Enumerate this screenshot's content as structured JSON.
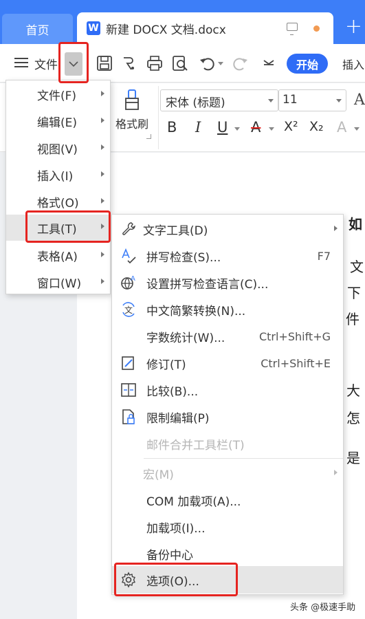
{
  "tabs": {
    "home": "首页",
    "document": "新建 DOCX 文档.docx",
    "doc_icon_letter": "W"
  },
  "toolbar": {
    "file_label": "文件",
    "start_button": "开始",
    "insert_label": "插入"
  },
  "ribbon": {
    "format_painter": "格式刷",
    "font_name": "宋体 (标题)",
    "font_size": "11",
    "bold": "B",
    "italic": "I",
    "underline": "U",
    "strike": "A",
    "superscript": "X²",
    "subscript": "X₂",
    "text_effect": "A",
    "font_color": "A"
  },
  "main_menu": {
    "items": [
      {
        "label": "文件(F)",
        "submenu": true
      },
      {
        "label": "编辑(E)",
        "submenu": true
      },
      {
        "label": "视图(V)",
        "submenu": true
      },
      {
        "label": "插入(I)",
        "submenu": true
      },
      {
        "label": "格式(O)",
        "submenu": true
      },
      {
        "label": "工具(T)",
        "submenu": true,
        "highlighted": true
      },
      {
        "label": "表格(A)",
        "submenu": true
      },
      {
        "label": "窗口(W)",
        "submenu": true
      }
    ]
  },
  "tools_menu": {
    "items": [
      {
        "label": "文字工具(D)",
        "icon": "wrench-icon",
        "submenu": true
      },
      {
        "label": "拼写检查(S)...",
        "icon": "spell-check-icon",
        "shortcut": "F7"
      },
      {
        "label": "设置拼写检查语言(C)...",
        "icon": "language-icon"
      },
      {
        "label": "中文简繁转换(N)...",
        "icon": "convert-icon"
      },
      {
        "label": "字数统计(W)...",
        "shortcut": "Ctrl+Shift+G"
      },
      {
        "label": "修订(T)",
        "icon": "revision-icon",
        "shortcut": "Ctrl+Shift+E"
      },
      {
        "label": "比较(B)...",
        "icon": "compare-icon"
      },
      {
        "label": "限制编辑(P)",
        "icon": "restrict-edit-icon"
      },
      {
        "label": "邮件合并工具栏(T)",
        "disabled": true
      },
      {
        "label": "宏(M)",
        "disabled": true,
        "submenu": true
      },
      {
        "label": "COM 加载项(A)..."
      },
      {
        "label": "加载项(I)..."
      },
      {
        "label": "备份中心"
      },
      {
        "label": "选项(O)...",
        "icon": "gear-icon",
        "highlighted": true
      }
    ]
  },
  "document": {
    "fragments": [
      "如",
      "文",
      "下",
      "件",
      "大",
      "怎",
      "是"
    ]
  },
  "watermark": "头条 @极速手助",
  "colors": {
    "accent": "#3d7ef8",
    "annotation": "#e52420",
    "highlight": "#e6e6e6"
  }
}
